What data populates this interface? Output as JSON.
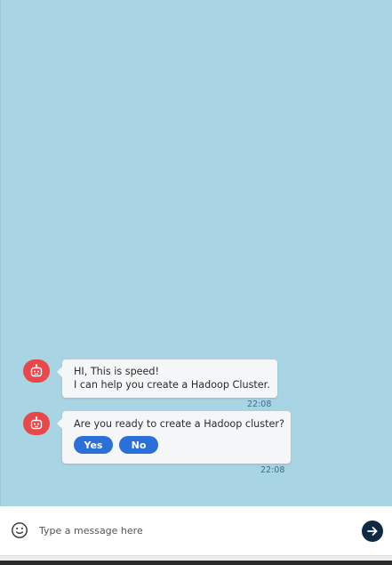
{
  "messages": [
    {
      "lines": [
        "HI, This is speed!",
        "I can help you create a Hadoop Cluster."
      ],
      "time": "22:08"
    },
    {
      "lines": [
        "Are you ready to create a Hadoop cluster?"
      ],
      "quick_replies": [
        "Yes",
        "No"
      ],
      "time": "22:08"
    }
  ],
  "composer": {
    "placeholder": "Type a message here",
    "emoji_icon": "smiley-icon",
    "send_icon": "arrow-right-icon"
  },
  "colors": {
    "chat_background": "#a8d4e4",
    "bot_avatar": "#e8484a",
    "quick_reply": "#2a70d8",
    "send_button": "#0f2a42"
  }
}
